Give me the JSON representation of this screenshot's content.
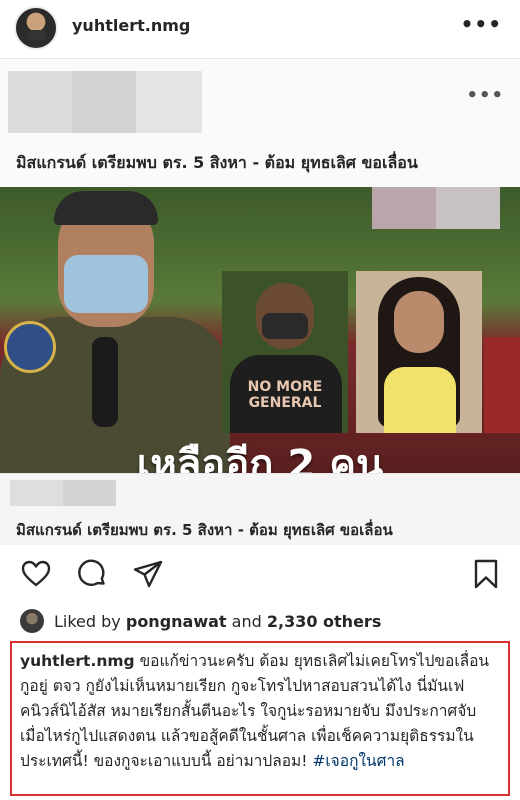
{
  "header": {
    "username": "yuhtlert.nmg",
    "more_icon": "more-horizontal-icon"
  },
  "shared_post": {
    "title_top": "มิสแกรนด์ เตรียมพบ ตร. 5 สิงหา - ต้อม ยุทธเลิศ ขอเลื่อน",
    "panel_shirt_text": "NO MORE GENERAL",
    "headline": "เหลืออีก 2 คน",
    "title_bottom": "มิสแกรนด์ เตรียมพบ ตร. 5 สิงหา - ต้อม ยุทธเลิศ ขอเลื่อน"
  },
  "actions": {
    "like_icon": "heart-icon",
    "comment_icon": "comment-icon",
    "share_icon": "paper-plane-icon",
    "save_icon": "bookmark-icon"
  },
  "likes": {
    "prefix": "Liked by",
    "user": "pongnawat",
    "middle": "and",
    "others": "2,330 others"
  },
  "caption": {
    "username": "yuhtlert.nmg",
    "text": "ขอแก้ข่าวนะครับ ต้อม ยุทธเลิศไม่เคยโทรไปขอเลื่อน กูอยู่ ตจว กูยังไม่เห็นหมายเรียก กูจะโทรไปหาสอบสวนได้ไง นี่มันเฟคนิวส์นิไอ้สัส หมายเรียกสั้นตีนอะไร ใจกูน่ะรอหมายจับ มึงประกาศจับเมื่อไหร่กูไปแสดงตน แล้วขอสู้คดีในชั้นศาล เพื่อเช็คความยุติธรรมในประเทศนี้! ของกูจะเอาแบบนี้ อย่ามาปลอม!",
    "hashtag": "#เจอกูในศาล"
  },
  "colors": {
    "highlight_border": "#d63030",
    "hashtag": "#00376b"
  }
}
